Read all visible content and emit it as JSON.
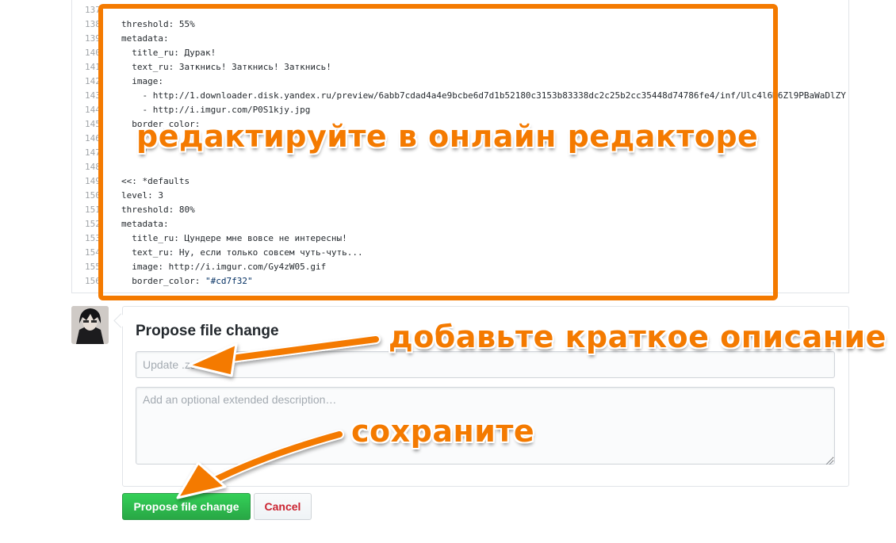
{
  "editor": {
    "lines": [
      {
        "n": "137",
        "text": ""
      },
      {
        "n": "138",
        "text": "threshold: 55%"
      },
      {
        "n": "139",
        "text": "metadata:"
      },
      {
        "n": "140",
        "text": "  title_ru: Дурак!"
      },
      {
        "n": "141",
        "text": "  text_ru: Заткнись! Заткнись! Заткнись!"
      },
      {
        "n": "142",
        "text": "  image:"
      },
      {
        "n": "143",
        "text": "    - http://1.downloader.disk.yandex.ru/preview/6abb7cdad4a4e9bcbe6d7d1b52180c3153b83338dc2c25b2cc35448d74786fe4/inf/Ulc4l6M6Zl9PBaWaDlZY"
      },
      {
        "n": "144",
        "text": "    - http://i.imgur.com/P0S1kjy.jpg"
      },
      {
        "n": "145",
        "text": "  border_color:"
      },
      {
        "n": "146",
        "text": ""
      },
      {
        "n": "147",
        "text": "    \""
      },
      {
        "n": "148",
        "text": ""
      },
      {
        "n": "149",
        "text": "<<: *defaults"
      },
      {
        "n": "150",
        "text": "level: 3"
      },
      {
        "n": "151",
        "text": "threshold: 80%"
      },
      {
        "n": "152",
        "text": "metadata:"
      },
      {
        "n": "153",
        "text": "  title_ru: Цундере мне вовсе не интересны!"
      },
      {
        "n": "154",
        "text": "  text_ru: Ну, если только совсем чуть-чуть..."
      },
      {
        "n": "155",
        "text": "  image: http://i.imgur.com/Gy4zW05.gif"
      },
      {
        "n": "156",
        "text": "  border_color: ",
        "str": "\"#cd7f32\""
      }
    ]
  },
  "annotations": {
    "edit": "редактируйте в онлайн редакторе",
    "describe": "добавьте краткое описание",
    "save": "сохраните"
  },
  "commit": {
    "title": "Propose file change",
    "summary_placeholder": "Update .zs",
    "description_placeholder": "Add an optional extended description…",
    "propose_label": "Propose file change",
    "cancel_label": "Cancel"
  },
  "colors": {
    "annotation": "#f47a00",
    "propose_button": "#28a745",
    "cancel_text": "#cb2431",
    "string_literal": "#032f62"
  },
  "icons": [
    "user-avatar",
    "resize-grip-icon",
    "arrow-pointer"
  ]
}
